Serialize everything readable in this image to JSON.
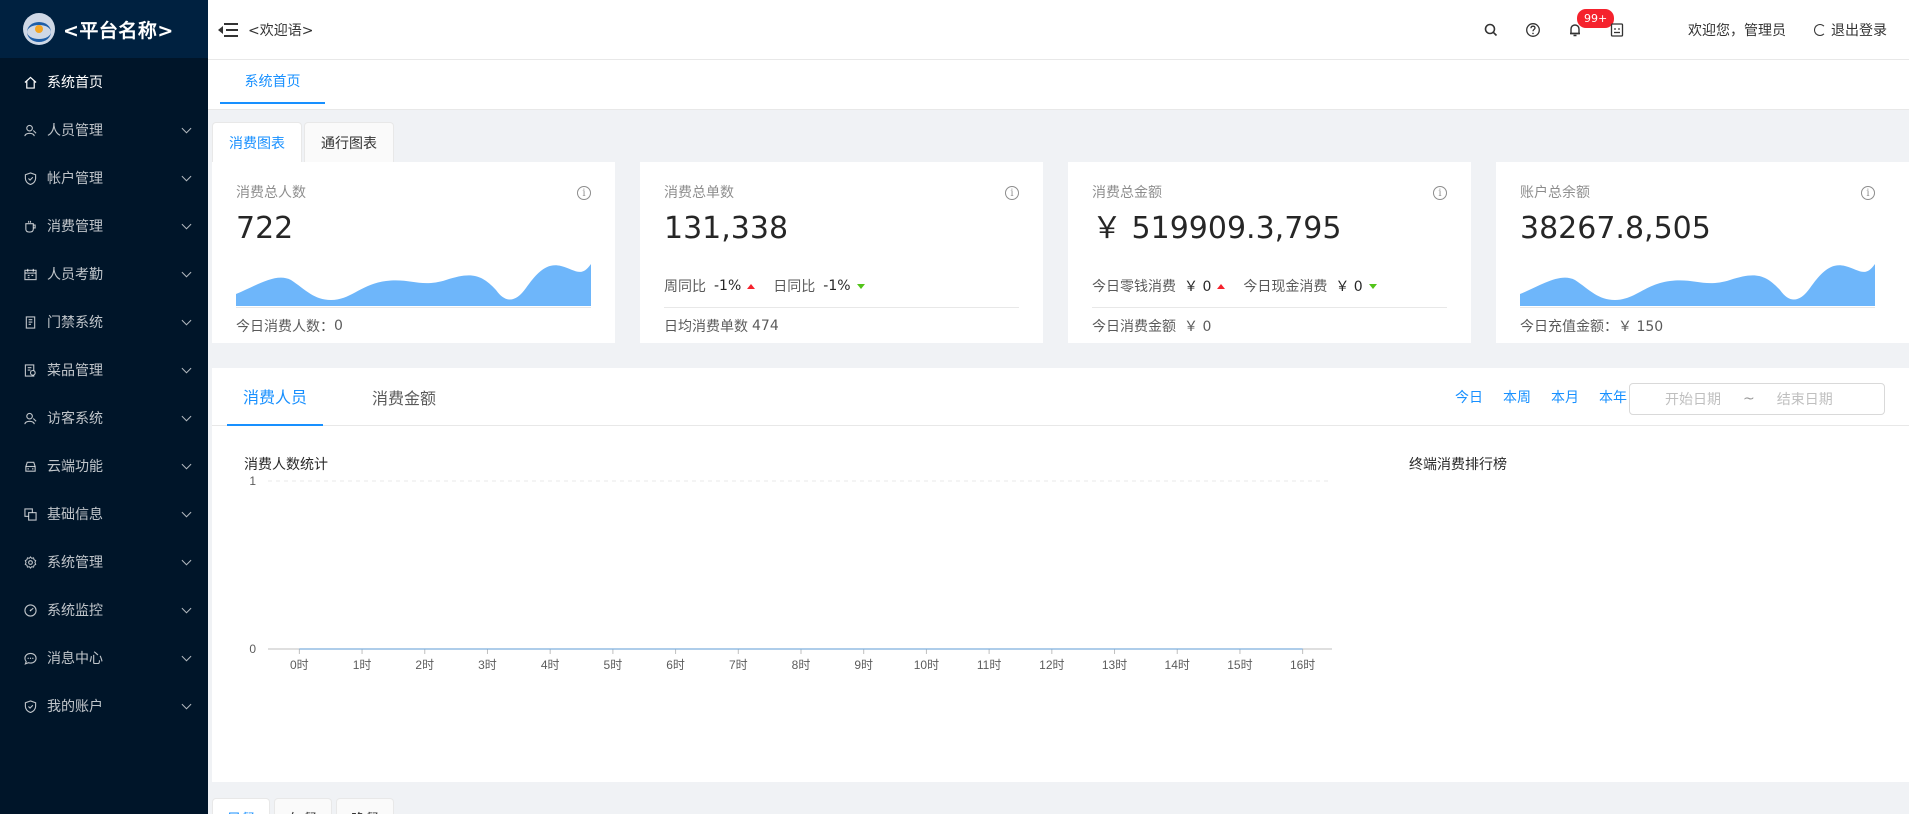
{
  "sidebar": {
    "logo_text": "<平台名称>",
    "items": [
      {
        "label": "系统首页",
        "icon": "home-icon",
        "active": true
      },
      {
        "label": "人员管理",
        "icon": "user-icon"
      },
      {
        "label": "帐户管理",
        "icon": "shield-icon"
      },
      {
        "label": "消费管理",
        "icon": "cup-icon"
      },
      {
        "label": "人员考勤",
        "icon": "calendar-icon"
      },
      {
        "label": "门禁系统",
        "icon": "door-icon"
      },
      {
        "label": "菜品管理",
        "icon": "dish-icon"
      },
      {
        "label": "访客系统",
        "icon": "visitor-icon"
      },
      {
        "label": "云端功能",
        "icon": "car-icon"
      },
      {
        "label": "基础信息",
        "icon": "copy-icon"
      },
      {
        "label": "系统管理",
        "icon": "gear-icon"
      },
      {
        "label": "系统监控",
        "icon": "dashboard-icon"
      },
      {
        "label": "消息中心",
        "icon": "message-icon"
      },
      {
        "label": "我的账户",
        "icon": "account-shield-icon"
      }
    ]
  },
  "header": {
    "welcome": "<欢迎语>",
    "notification_count": "99+",
    "greeting": "欢迎您，管理员",
    "logout": "退出登录"
  },
  "page_tabs": {
    "home": "系统首页"
  },
  "card_tabs": [
    "消费图表",
    "通行图表"
  ],
  "stats": {
    "people": {
      "title": "消费总人数",
      "value": "722",
      "footer_label": "今日消费人数：",
      "footer_value": "0"
    },
    "orders": {
      "title": "消费总单数",
      "value": "131,338",
      "week_label": "周同比",
      "week_value": "-1%",
      "day_label": "日同比",
      "day_value": "-1%",
      "footer_label": "日均消费单数",
      "footer_value": "474"
    },
    "amount": {
      "title": "消费总金额",
      "value": "￥ 519909.3,795",
      "change_label": "今日零钱消费",
      "change_value": "￥ 0",
      "cash_label": "今日现金消费",
      "cash_value": "￥ 0",
      "footer_label": "今日消费金额",
      "footer_value": "￥ 0"
    },
    "balance": {
      "title": "账户总余额",
      "value": "38267.8,505",
      "footer_label": "今日充值金额：",
      "footer_value": "￥ 150"
    }
  },
  "main_panel": {
    "tabs": [
      "消费人员",
      "消费金额"
    ],
    "ranges": [
      "今日",
      "本周",
      "本月",
      "本年"
    ],
    "start_placeholder": "开始日期",
    "separator": "~",
    "end_placeholder": "结束日期",
    "chart_title": "消费人数统计",
    "rank_title": "终端消费排行榜"
  },
  "bottom_tabs": [
    "早餐",
    "午餐",
    "晚餐"
  ],
  "colors": {
    "sidebar_bg": "#001529",
    "accent": "#1890ff",
    "area_fill": "#6eb6fa",
    "up": "#f5222d",
    "down": "#52c41a"
  },
  "chart_data": {
    "type": "line",
    "title": "消费人数统计",
    "categories": [
      "0时",
      "1时",
      "2时",
      "3时",
      "4时",
      "5时",
      "6时",
      "7时",
      "8时",
      "9时",
      "10时",
      "11时",
      "12时",
      "13时",
      "14时",
      "15时",
      "16时"
    ],
    "series": [
      {
        "values": [
          0,
          0,
          0,
          0,
          0,
          0,
          0,
          0,
          0,
          0,
          0,
          0,
          0,
          0,
          0,
          0,
          0
        ]
      }
    ],
    "ylim": [
      0,
      1
    ],
    "yticks": [
      "0",
      "1"
    ],
    "grid": true
  }
}
